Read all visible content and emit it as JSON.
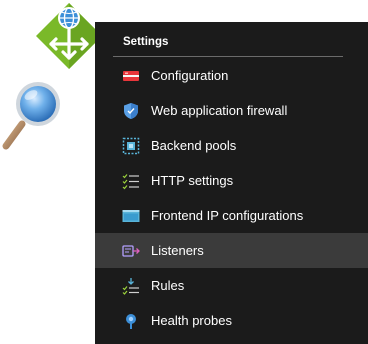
{
  "logos": {
    "app_gateway": "application-gateway-icon",
    "magnifier": "magnifying-glass-icon"
  },
  "settings": {
    "heading": "Settings",
    "selected_index": 5,
    "items": [
      {
        "label": "Configuration",
        "icon": "configuration-icon",
        "icon_color": "#e8363b"
      },
      {
        "label": "Web application firewall",
        "icon": "shield-icon",
        "icon_color": "#5aa0e6"
      },
      {
        "label": "Backend pools",
        "icon": "backend-pool-icon",
        "icon_color": "#59b4d9"
      },
      {
        "label": "HTTP settings",
        "icon": "list-settings-icon",
        "icon_color": "#9ad13b"
      },
      {
        "label": "Frontend IP configurations",
        "icon": "monitor-icon",
        "icon_color": "#59b4d9"
      },
      {
        "label": "Listeners",
        "icon": "listener-icon",
        "icon_color": "#b4a0ff"
      },
      {
        "label": "Rules",
        "icon": "rules-icon",
        "icon_color": "#59b4d9"
      },
      {
        "label": "Health probes",
        "icon": "health-probe-icon",
        "icon_color": "#3c8fd8"
      }
    ]
  },
  "colors": {
    "panel_bg": "#1b1b1b",
    "selected_bg": "#3b3b3b",
    "text": "#ffffff",
    "logo_green": "#7ab929"
  }
}
